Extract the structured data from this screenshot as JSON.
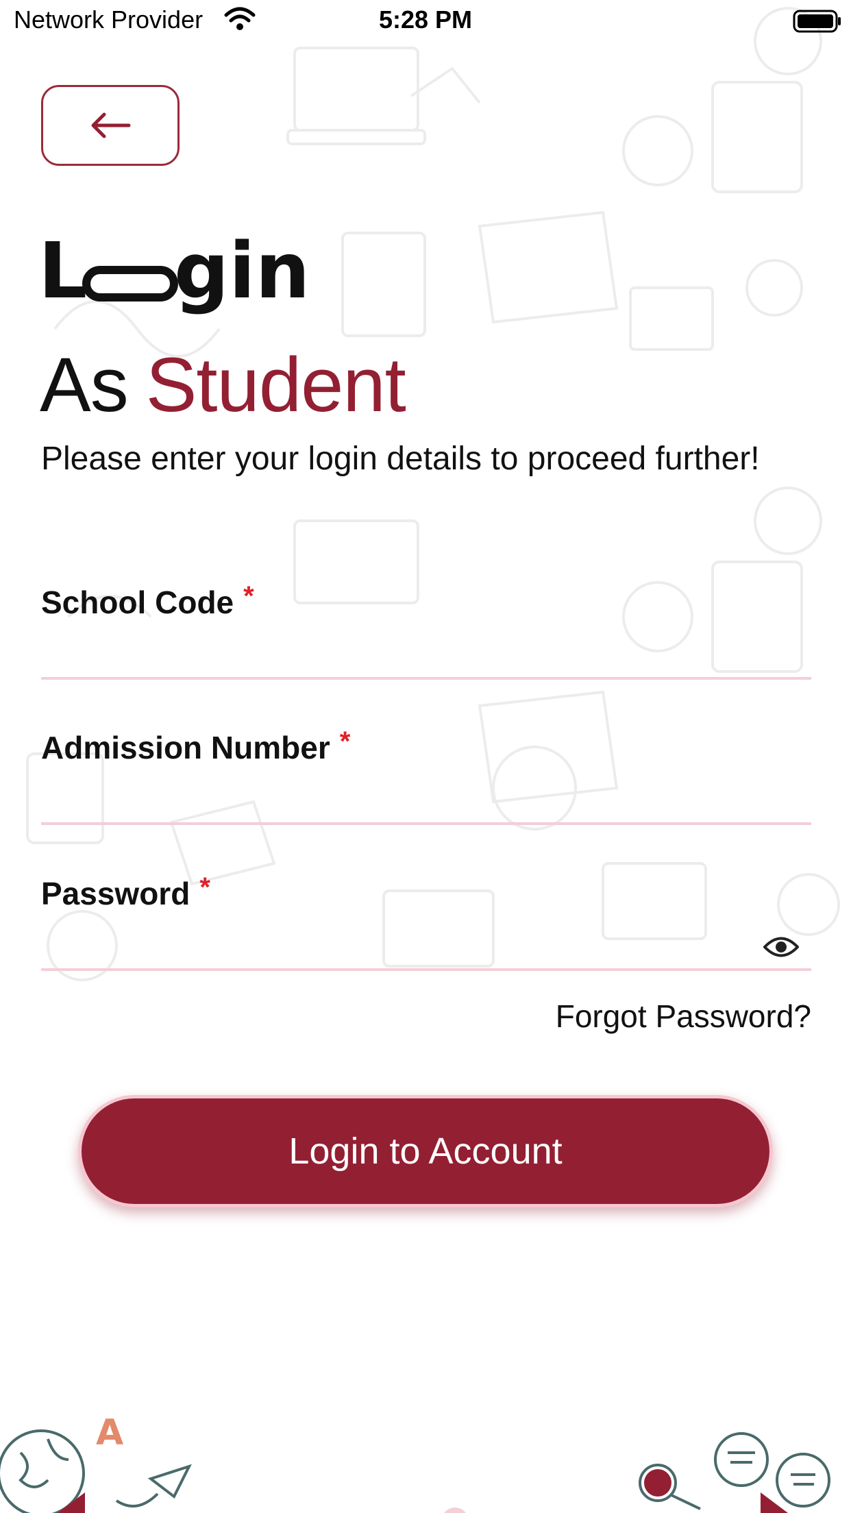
{
  "status_bar": {
    "carrier": "Network Provider",
    "time": "5:28 PM"
  },
  "header": {
    "logo_text": "Login",
    "as_text": "As",
    "role_text": "Student",
    "subtitle": "Please enter your login details to proceed further!"
  },
  "form": {
    "school_code": {
      "label": "School Code",
      "required_mark": "*",
      "value": "",
      "placeholder": ""
    },
    "admission_number": {
      "label": "Admission Number",
      "required_mark": "*",
      "value": "",
      "placeholder": ""
    },
    "password": {
      "label": "Password",
      "required_mark": "*",
      "value": "",
      "placeholder": ""
    },
    "forgot_password": "Forgot Password?",
    "submit_label": "Login to Account"
  },
  "colors": {
    "brand": "#931f33",
    "required": "#e0202a",
    "underline": "#f3cfd7"
  },
  "icons": [
    "back-arrow-icon",
    "eye-icon",
    "wifi-icon",
    "battery-icon"
  ]
}
